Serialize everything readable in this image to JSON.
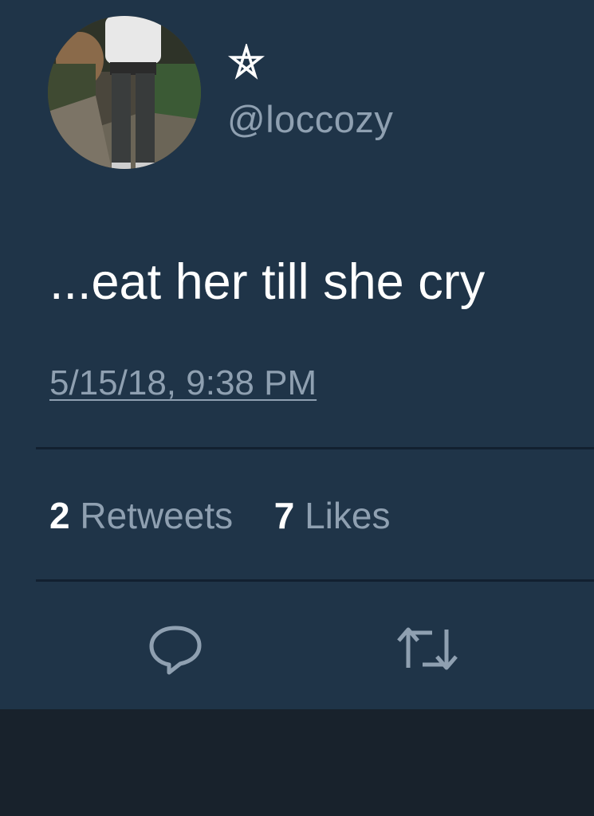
{
  "tweet": {
    "handle": "@loccozy",
    "text": "...eat her till she cry",
    "timestamp": "5/15/18, 9:38 PM",
    "stats": {
      "retweets_count": "2",
      "retweets_label": "Retweets",
      "likes_count": "7",
      "likes_label": "Likes"
    },
    "actions": {
      "reply_icon": "reply-icon",
      "retweet_icon": "retweet-icon"
    }
  },
  "colors": {
    "card_background": "#1f3448",
    "text_primary": "#ffffff",
    "text_secondary": "#8fa0b1",
    "bottom_bar": "#18222c"
  }
}
